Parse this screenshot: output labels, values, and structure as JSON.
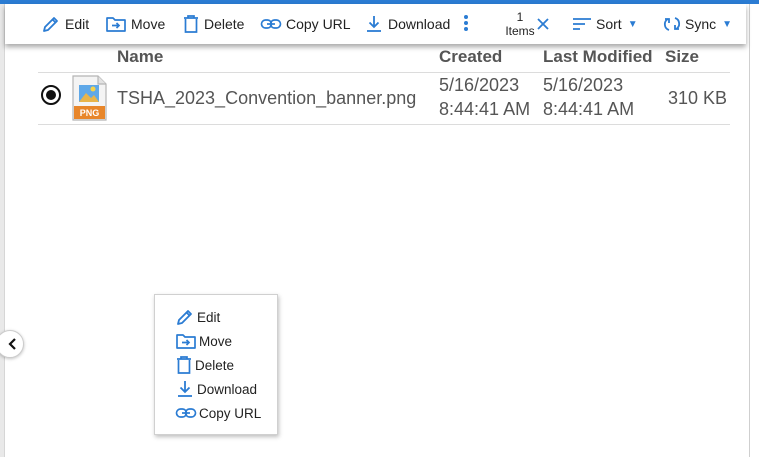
{
  "toolbar": {
    "edit": "Edit",
    "move": "Move",
    "delete": "Delete",
    "copy_url": "Copy URL",
    "download": "Download",
    "items_count": "1",
    "items_label": "Items",
    "sort": "Sort",
    "sync": "Sync"
  },
  "table": {
    "columns": [
      "Name",
      "Created",
      "Last Modified",
      "Size"
    ],
    "rows": [
      {
        "name": "TSHA_2023_Convention_banner.png",
        "file_type": "PNG",
        "created_date": "5/16/2023",
        "created_time": "8:44:41 AM",
        "modified_date": "5/16/2023",
        "modified_time": "8:44:41 AM",
        "size": "310 KB",
        "selected": true
      }
    ]
  },
  "context_menu": {
    "items": [
      "Edit",
      "Move",
      "Delete",
      "Download",
      "Copy URL"
    ]
  },
  "colors": {
    "accent": "#2b7cd3",
    "png_badge": "#e8862a"
  }
}
